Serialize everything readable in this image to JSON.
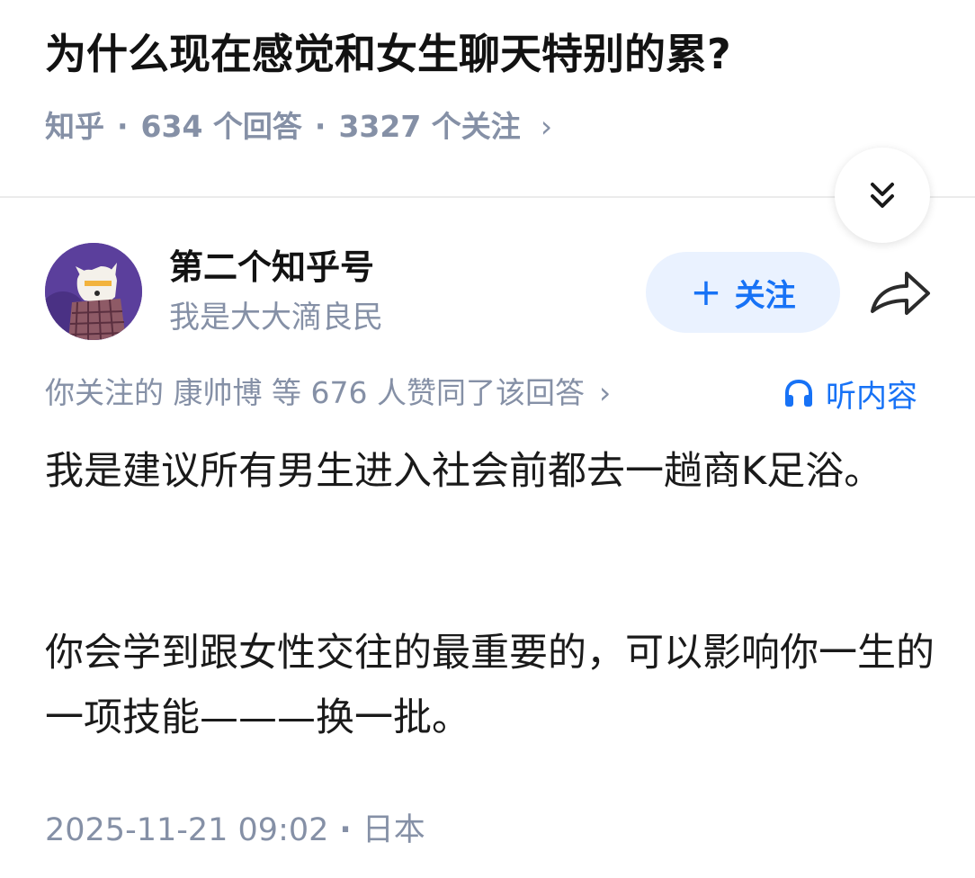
{
  "question": {
    "title": "为什么现在感觉和女生聊天特别的累?",
    "source": "知乎",
    "answers_count": "634 个回答",
    "followers_count": "3327 个关注"
  },
  "author": {
    "name": "第二个知乎号",
    "bio": "我是大大滴良民",
    "follow_label": "关注"
  },
  "answer": {
    "likes_prefix": "你关注的",
    "likes_friend": "康帅博",
    "likes_suffix": "等 676 人赞同了该回答",
    "listen_label": "听内容",
    "paragraphs": [
      "我是建议所有男生进入社会前都去一趟商K足浴。",
      "你会学到跟女性交往的最重要的，可以影响你一生的一项技能———换一批。"
    ],
    "datetime": "2025-11-21 09:02",
    "location": "日本"
  },
  "colors": {
    "accent": "#1772f6",
    "meta": "#8590a6",
    "follow_bg": "#eaf2ff"
  },
  "icons": {
    "collapse": "double-chevron-down-icon",
    "share": "share-arrow-icon",
    "listen": "headphones-icon"
  }
}
